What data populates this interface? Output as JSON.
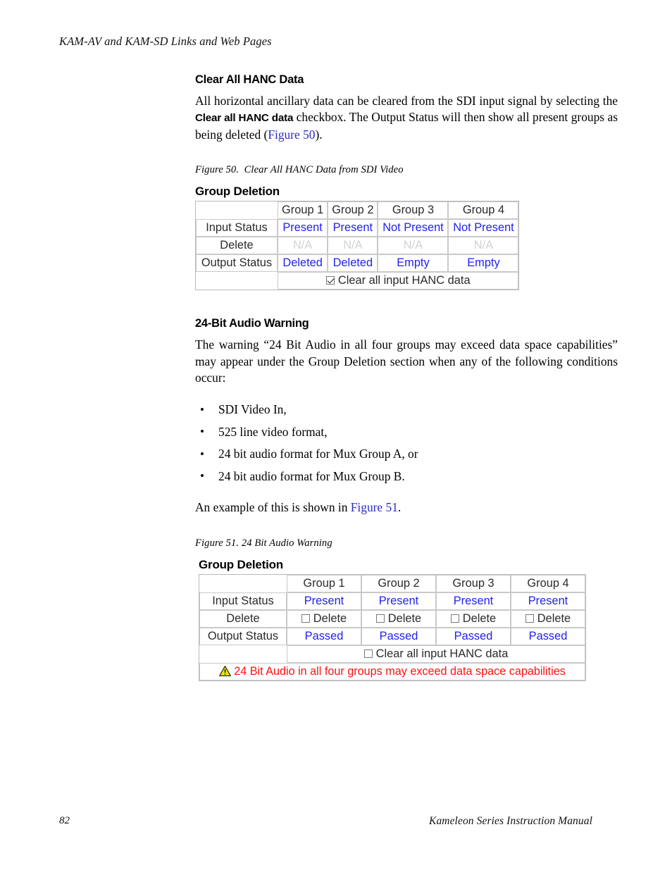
{
  "header": {
    "running_head": "KAM-AV and KAM-SD Links and Web Pages"
  },
  "footer": {
    "page_number": "82",
    "manual_title": "Kameleon Series Instruction Manual"
  },
  "sections": [
    {
      "heading": "Clear All HANC Data",
      "paragraph_part1": "All horizontal ancillary data can be cleared from the SDI input signal by selecting the ",
      "paragraph_bold": "Clear all HANC data",
      "paragraph_part2": " checkbox. The Output Status will then show all present groups as being deleted (",
      "paragraph_xref": "Figure 50",
      "paragraph_part3": ")."
    },
    {
      "heading": "24-Bit Audio Warning",
      "paragraph": "The warning “24 Bit Audio in all four groups may exceed data space capabilities” may appear under the Group Deletion section when any of the following conditions occur:",
      "bullets": [
        "SDI Video In,",
        "525 line video format,",
        "24 bit audio format for Mux Group A, or",
        "24 bit audio format for Mux Group B."
      ],
      "closing_part1": "An example of this is shown in ",
      "closing_xref": "Figure 51",
      "closing_part2": "."
    }
  ],
  "figure50": {
    "caption_label": "Figure 50.",
    "caption_text": "Clear All HANC Data from SDI Video",
    "panel_title": "Group Deletion",
    "columns": [
      "Group 1",
      "Group 2",
      "Group 3",
      "Group 4"
    ],
    "rows": [
      {
        "label": "Input Status",
        "values": [
          "Present",
          "Present",
          "Not Present",
          "Not Present"
        ]
      },
      {
        "label": "Delete",
        "values": [
          "N/A",
          "N/A",
          "N/A",
          "N/A"
        ]
      },
      {
        "label": "Output Status",
        "values": [
          "Deleted",
          "Deleted",
          "Empty",
          "Empty"
        ]
      }
    ],
    "clear_all": {
      "label": "Clear all input HANC data",
      "checked": "true"
    }
  },
  "figure51": {
    "caption_label": "Figure 51.",
    "caption_text": "24 Bit Audio Warning",
    "panel_title": "Group Deletion",
    "columns": [
      "Group 1",
      "Group 2",
      "Group 3",
      "Group 4"
    ],
    "rows": [
      {
        "label": "Input Status",
        "values": [
          "Present",
          "Present",
          "Present",
          "Present"
        ]
      },
      {
        "label": "Delete",
        "values": [
          "Delete",
          "Delete",
          "Delete",
          "Delete"
        ]
      },
      {
        "label": "Output Status",
        "values": [
          "Passed",
          "Passed",
          "Passed",
          "Passed"
        ]
      }
    ],
    "clear_all": {
      "label": "Clear all input HANC data",
      "checked": "false"
    },
    "warning": {
      "icon": "warning-triangle-icon",
      "text": "24 Bit Audio in all four groups may exceed data space capabilities"
    }
  },
  "colors": {
    "link": "#2b2bc8",
    "value_blue": "#2222ee",
    "disabled_gray": "#d2d2d2",
    "warning_red": "#ff1111",
    "warning_yellow": "#ffe400"
  }
}
